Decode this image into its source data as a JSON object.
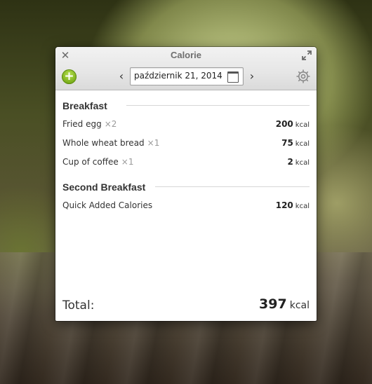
{
  "window": {
    "title": "Calorie"
  },
  "toolbar": {
    "date": "październik 21, 2014"
  },
  "icons": {
    "close": "close-icon",
    "maximize": "maximize-icon",
    "add": "add-icon",
    "prev": "chevron-left-icon",
    "next": "chevron-right-icon",
    "calendar": "calendar-icon",
    "settings": "gear-icon"
  },
  "colors": {
    "accent_green": "#79ad1a"
  },
  "sections": [
    {
      "title": "Breakfast",
      "items": [
        {
          "name": "Fried egg",
          "count": "×2",
          "kcal": "200",
          "unit": "kcal"
        },
        {
          "name": "Whole wheat bread",
          "count": "×1",
          "kcal": "75",
          "unit": "kcal"
        },
        {
          "name": "Cup of coffee",
          "count": "×1",
          "kcal": "2",
          "unit": "kcal"
        }
      ]
    },
    {
      "title": "Second Breakfast",
      "items": [
        {
          "name": "Quick Added Calories",
          "count": "",
          "kcal": "120",
          "unit": "kcal"
        }
      ]
    }
  ],
  "total": {
    "label": "Total:",
    "value": "397",
    "unit": "kcal"
  }
}
